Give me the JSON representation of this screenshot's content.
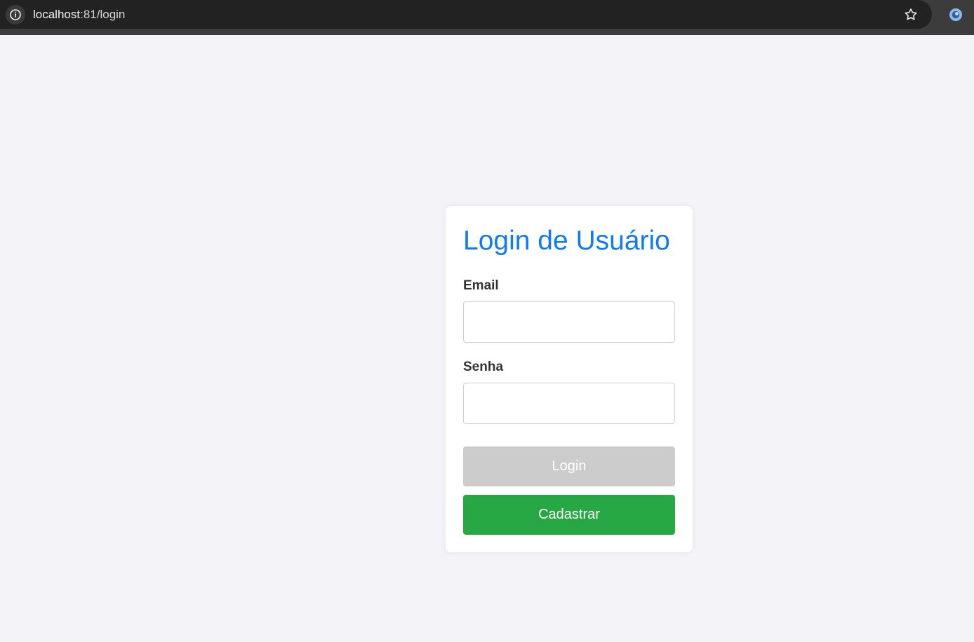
{
  "browser": {
    "url_host": "localhost",
    "url_rest": ":81/login",
    "site_info_icon": "info-icon",
    "bookmark_icon": "star-icon",
    "extension_icon": "extension-icon"
  },
  "login": {
    "title": "Login de Usuário",
    "email": {
      "label": "Email",
      "value": "",
      "placeholder": ""
    },
    "password": {
      "label": "Senha",
      "value": "",
      "placeholder": ""
    },
    "buttons": {
      "login_label": "Login",
      "register_label": "Cadastrar"
    }
  },
  "colors": {
    "page_background": "#f4f4f8",
    "card_background": "#ffffff",
    "title": "#0d7bf4",
    "login_disabled": "#cccccc",
    "register": "#28a745",
    "browser_bar": "#222222"
  }
}
